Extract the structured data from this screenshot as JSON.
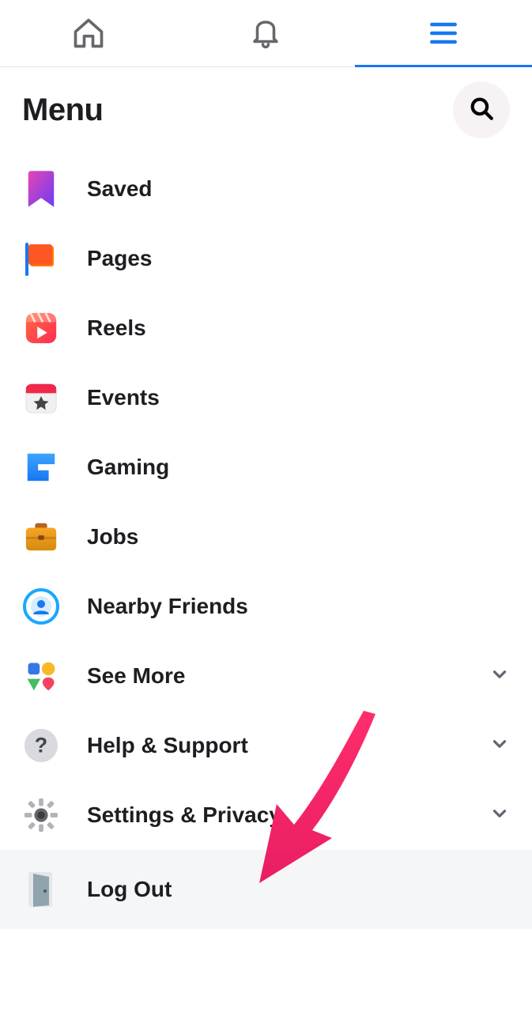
{
  "header": {
    "title": "Menu"
  },
  "menu": {
    "saved": {
      "label": "Saved"
    },
    "pages": {
      "label": "Pages"
    },
    "reels": {
      "label": "Reels"
    },
    "events": {
      "label": "Events"
    },
    "gaming": {
      "label": "Gaming"
    },
    "jobs": {
      "label": "Jobs"
    },
    "nearby": {
      "label": "Nearby Friends"
    },
    "seemore": {
      "label": "See More"
    },
    "help": {
      "label": "Help & Support"
    },
    "settings": {
      "label": "Settings & Privacy"
    },
    "logout": {
      "label": "Log Out"
    }
  }
}
